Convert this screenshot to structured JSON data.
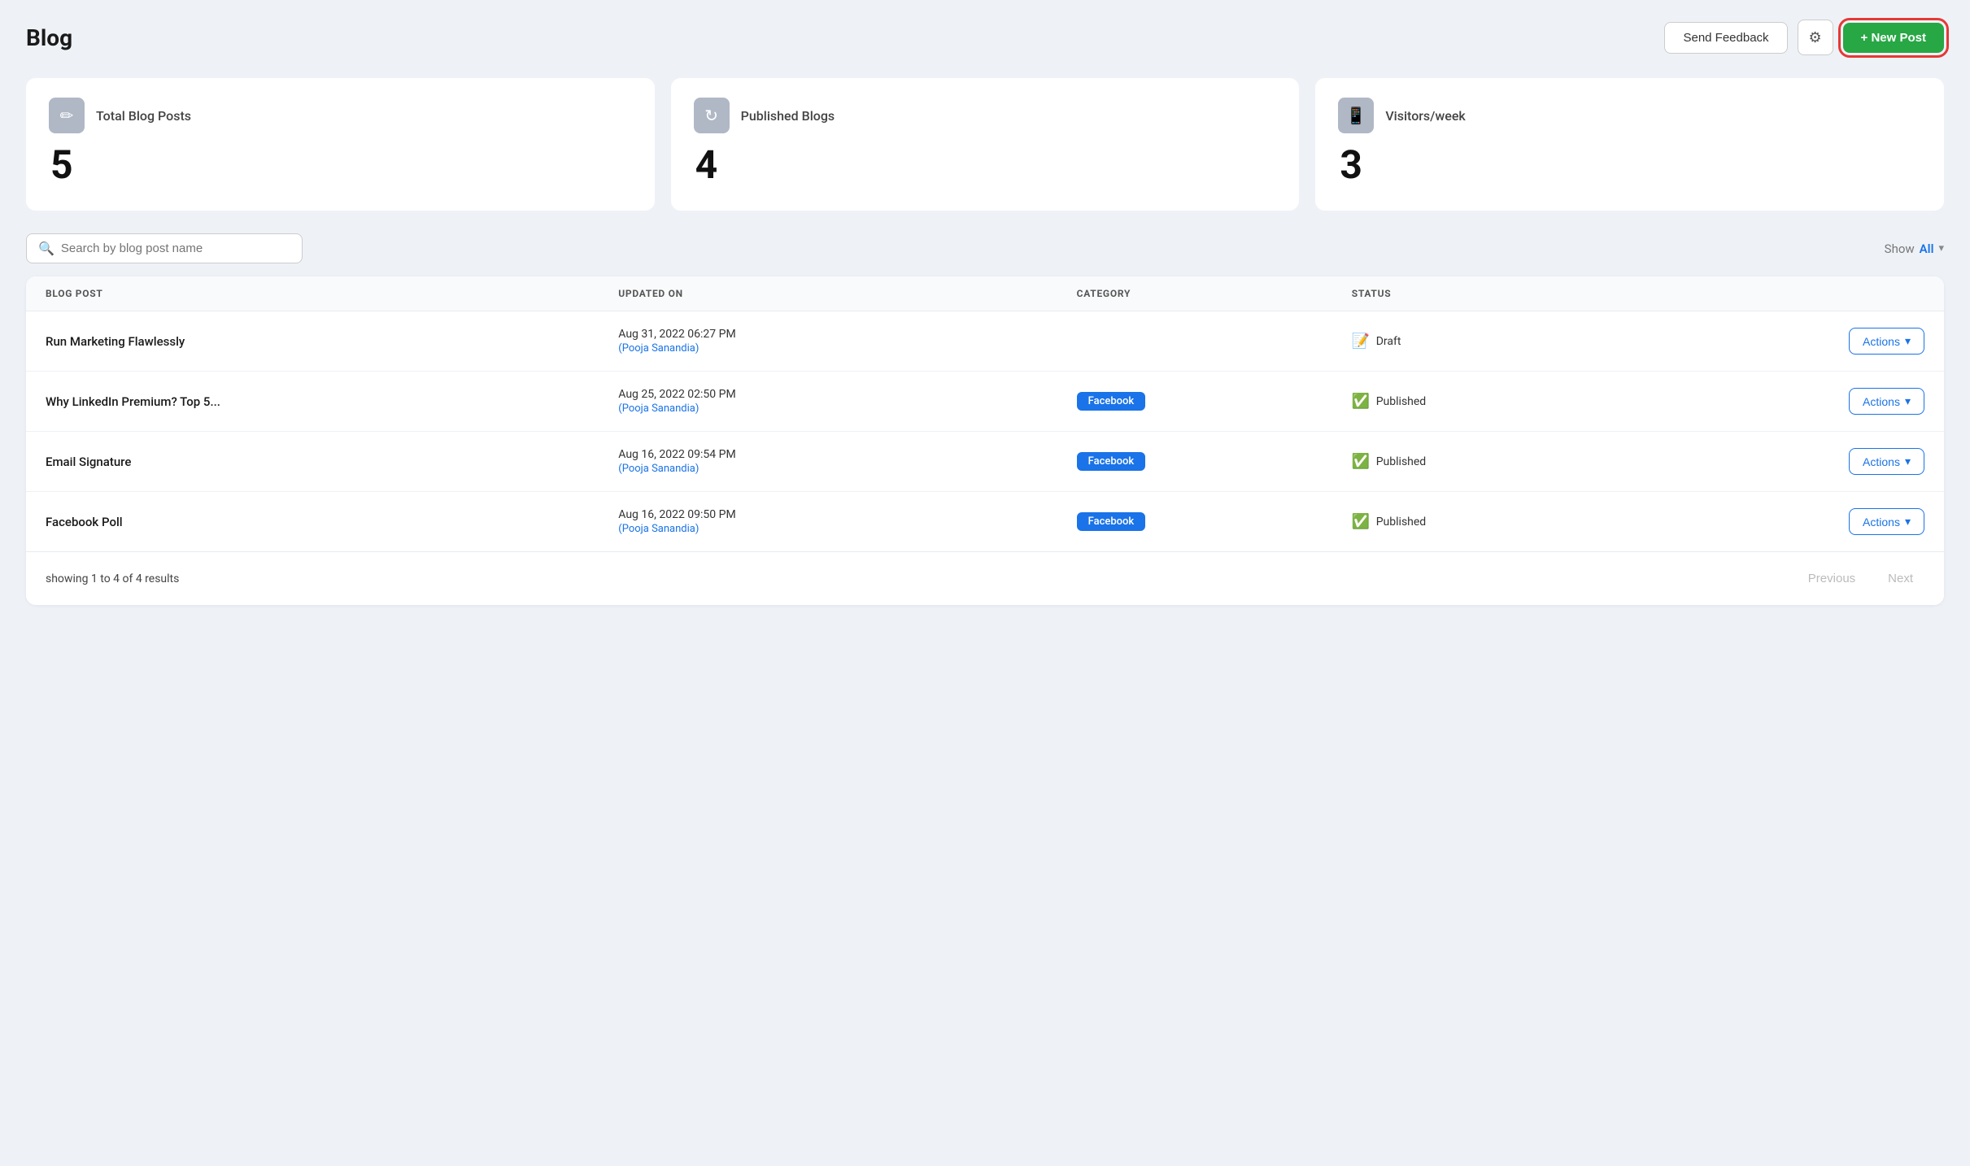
{
  "header": {
    "title": "Blog",
    "feedback_label": "Send Feedback",
    "new_post_label": "+ New Post",
    "gear_icon": "⚙"
  },
  "stats": [
    {
      "id": "total",
      "icon": "✏",
      "label": "Total Blog Posts",
      "value": "5"
    },
    {
      "id": "published",
      "icon": "↻",
      "label": "Published Blogs",
      "value": "4"
    },
    {
      "id": "visitors",
      "icon": "📱",
      "label": "Visitors/week",
      "value": "3"
    }
  ],
  "toolbar": {
    "search_placeholder": "Search by blog post name",
    "show_label": "Show",
    "show_value": "All",
    "chevron": "▾"
  },
  "table": {
    "columns": [
      "BLOG POST",
      "UPDATED ON",
      "CATEGORY",
      "STATUS",
      ""
    ],
    "rows": [
      {
        "title": "Run Marketing Flawlessly",
        "date": "Aug 31, 2022 06:27 PM",
        "author": "(Pooja Sanandia)",
        "category": "",
        "status": "Draft",
        "status_type": "draft",
        "actions_label": "Actions"
      },
      {
        "title": "Why LinkedIn Premium? Top 5...",
        "date": "Aug 25, 2022 02:50 PM",
        "author": "(Pooja Sanandia)",
        "category": "Facebook",
        "status": "Published",
        "status_type": "published",
        "actions_label": "Actions"
      },
      {
        "title": "Email Signature",
        "date": "Aug 16, 2022 09:54 PM",
        "author": "(Pooja Sanandia)",
        "category": "Facebook",
        "status": "Published",
        "status_type": "published",
        "actions_label": "Actions"
      },
      {
        "title": "Facebook Poll",
        "date": "Aug 16, 2022 09:50 PM",
        "author": "(Pooja Sanandia)",
        "category": "Facebook",
        "status": "Published",
        "status_type": "published",
        "actions_label": "Actions"
      }
    ]
  },
  "footer": {
    "results_text": "showing 1 to 4 of 4 results",
    "previous_label": "Previous",
    "next_label": "Next"
  }
}
